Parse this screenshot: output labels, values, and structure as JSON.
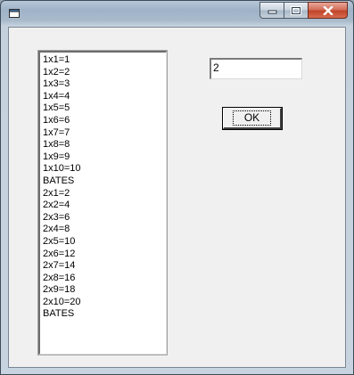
{
  "window": {
    "title_icon": "window-app-icon",
    "minimize_icon": "minimize-icon",
    "maximize_icon": "maximize-icon",
    "close_icon": "close-icon"
  },
  "list": {
    "items": [
      "1x1=1",
      "1x2=2",
      "1x3=3",
      "1x4=4",
      "1x5=5",
      "1x6=6",
      "1x7=7",
      "1x8=8",
      "1x9=9",
      "1x10=10",
      "BATES",
      "2x1=2",
      "2x2=4",
      "2x3=6",
      "2x4=8",
      "2x5=10",
      "2x6=12",
      "2x7=14",
      "2x8=16",
      "2x9=18",
      "2x10=20",
      "BATES"
    ]
  },
  "input": {
    "value": "2"
  },
  "ok_button": {
    "label": "OK"
  },
  "colors": {
    "client_bg": "#f0f0f0",
    "close_button": "#c0442a",
    "titlebar": "#a9bacb"
  }
}
